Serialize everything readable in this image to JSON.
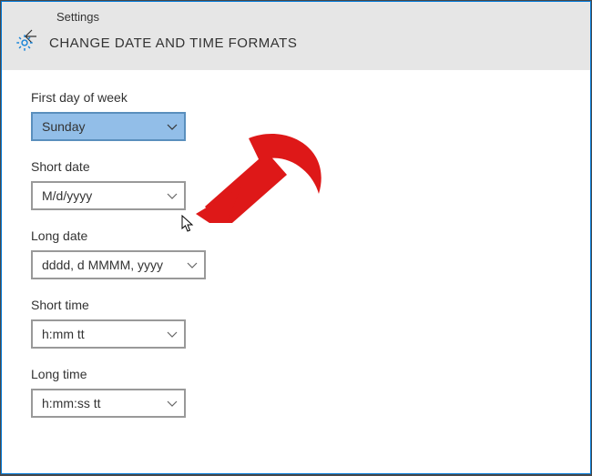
{
  "header": {
    "app_label": "Settings",
    "page_title": "CHANGE DATE AND TIME FORMATS"
  },
  "fields": {
    "first_day": {
      "label": "First day of week",
      "value": "Sunday"
    },
    "short_date": {
      "label": "Short date",
      "value": "M/d/yyyy"
    },
    "long_date": {
      "label": "Long date",
      "value": "dddd, d MMMM, yyyy"
    },
    "short_time": {
      "label": "Short time",
      "value": "h:mm tt"
    },
    "long_time": {
      "label": "Long time",
      "value": "h:mm:ss tt"
    }
  }
}
